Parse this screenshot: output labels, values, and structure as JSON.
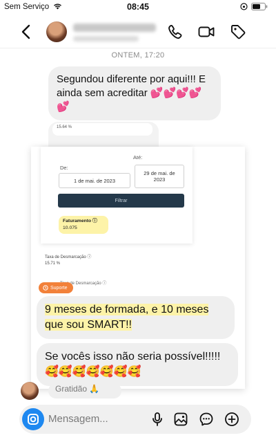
{
  "status_bar": {
    "carrier": "Sem Serviço",
    "time": "08:45"
  },
  "header": {
    "icons": [
      "back-icon",
      "phone-icon",
      "video-icon",
      "tag-icon"
    ]
  },
  "thread": {
    "date_separator": "ONTEM, 17:20",
    "message_1": "Segundou diferente por aqui!!! E ainda sem acreditar 💕💕💕💕💕"
  },
  "screenshot": {
    "mini_value_top": "15.64 %",
    "from_label": "De:",
    "to_label": "Até:",
    "from_date": "1 de mai. de 2023",
    "to_date": "29 de mai. de 2023",
    "filter_button": "Filtrar",
    "revenue_label": "Faturamento ⓘ",
    "revenue_value": "10.075",
    "support_label": "Suporte",
    "mini_label_1": "Taxa de Desmarcação ⓘ",
    "mini_value_1": "15.71 %",
    "mini_label_2": "Taxa de Desmarcação ⓘ",
    "message_2": "9 meses de formada, e 10 meses que sou SMART!!",
    "message_3": "Se vocês isso não seria possível!!!!! 🥰🥰🥰🥰🥰🥰🥰"
  },
  "behind_message": "Gratidão 🙏",
  "composer": {
    "placeholder": "Mensagem...",
    "icons": [
      "camera-icon",
      "microphone-icon",
      "gallery-icon",
      "sticker-icon",
      "plus-icon"
    ]
  },
  "colors": {
    "accent": "#1e88f0",
    "highlight": "#fdf3a8",
    "bubble": "#efefef",
    "filter_button": "#24394a",
    "support": "#f2813a"
  }
}
